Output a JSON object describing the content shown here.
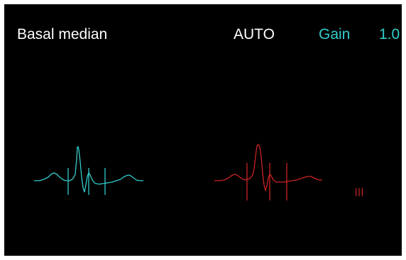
{
  "header": {
    "title": "Basal median",
    "mode": "AUTO",
    "gain_label": "Gain",
    "gain_value": "1.0"
  },
  "traces": {
    "left_color": "#33cccc",
    "right_color": "#cc2222",
    "right_lead_label": "III"
  },
  "colors": {
    "background": "#000000",
    "text": "#ffffff",
    "accent": "#33cccc"
  }
}
